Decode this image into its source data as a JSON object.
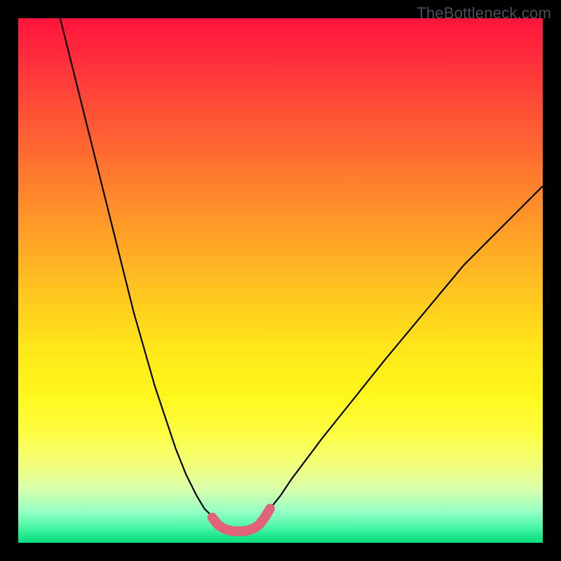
{
  "watermark": "TheBottleneck.com",
  "chart_data": {
    "type": "line",
    "title": "",
    "xlabel": "",
    "ylabel": "",
    "xlim": [
      0,
      100
    ],
    "ylim": [
      0,
      100
    ],
    "grid": false,
    "series": [
      {
        "name": "left-curve",
        "stroke": "#000000",
        "x": [
          8,
          10,
          12,
          14,
          16,
          18,
          20,
          22,
          24,
          26,
          28,
          30,
          32,
          34,
          35.5,
          37,
          38
        ],
        "y": [
          100,
          92,
          84,
          76,
          68,
          60,
          52,
          44,
          37,
          30,
          24,
          18,
          13,
          9,
          6.5,
          5,
          4.2
        ]
      },
      {
        "name": "valley-pink",
        "stroke": "#e06377",
        "thick": true,
        "x": [
          37,
          38,
          39,
          40,
          41,
          42,
          43,
          44,
          45,
          46,
          47,
          48
        ],
        "y": [
          4.8,
          3.5,
          2.8,
          2.4,
          2.2,
          2.2,
          2.2,
          2.4,
          2.8,
          3.5,
          4.8,
          6.5
        ]
      },
      {
        "name": "right-curve",
        "stroke": "#000000",
        "x": [
          47,
          48,
          50,
          52,
          55,
          58,
          62,
          66,
          70,
          75,
          80,
          85,
          90,
          95,
          100
        ],
        "y": [
          5.2,
          6.5,
          9,
          12,
          16,
          20,
          25,
          30,
          35,
          41,
          47,
          53,
          58,
          63,
          68
        ]
      }
    ],
    "gradient_stops": [
      {
        "pos": 0,
        "color": "#ff143c"
      },
      {
        "pos": 50,
        "color": "#ffc81f"
      },
      {
        "pos": 80,
        "color": "#fdfe42"
      },
      {
        "pos": 100,
        "color": "#10de83"
      }
    ]
  }
}
